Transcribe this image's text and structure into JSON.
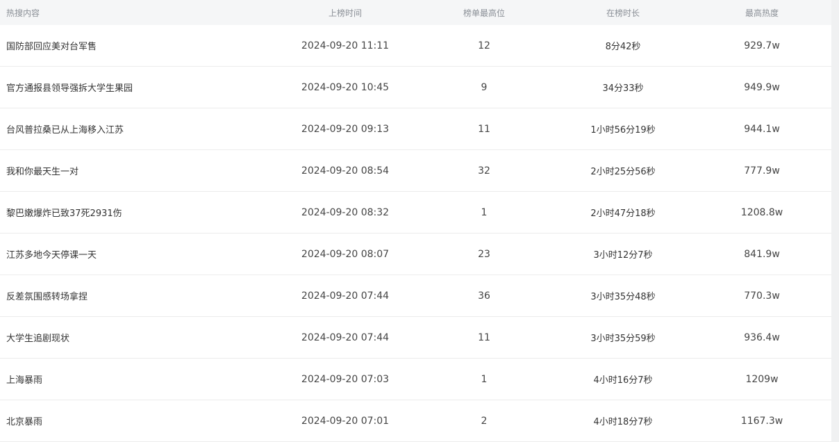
{
  "header": {
    "topic": "热搜内容",
    "time": "上榜时间",
    "rank": "榜单最高位",
    "duration": "在榜时长",
    "heat": "最高热度"
  },
  "rows": [
    {
      "topic": "国防部回应美对台军售",
      "time": "2024-09-20 11:11",
      "rank": "12",
      "duration": "8分42秒",
      "heat": "929.7w"
    },
    {
      "topic": "官方通报县领导强拆大学生果园",
      "time": "2024-09-20 10:45",
      "rank": "9",
      "duration": "34分33秒",
      "heat": "949.9w"
    },
    {
      "topic": "台风普拉桑已从上海移入江苏",
      "time": "2024-09-20 09:13",
      "rank": "11",
      "duration": "1小时56分19秒",
      "heat": "944.1w"
    },
    {
      "topic": "我和你最天生一对",
      "time": "2024-09-20 08:54",
      "rank": "32",
      "duration": "2小时25分56秒",
      "heat": "777.9w"
    },
    {
      "topic": "黎巴嫩爆炸已致37死2931伤",
      "time": "2024-09-20 08:32",
      "rank": "1",
      "duration": "2小时47分18秒",
      "heat": "1208.8w"
    },
    {
      "topic": "江苏多地今天停课一天",
      "time": "2024-09-20 08:07",
      "rank": "23",
      "duration": "3小时12分7秒",
      "heat": "841.9w"
    },
    {
      "topic": "反差氛围感转场拿捏",
      "time": "2024-09-20 07:44",
      "rank": "36",
      "duration": "3小时35分48秒",
      "heat": "770.3w"
    },
    {
      "topic": "大学生追剧现状",
      "time": "2024-09-20 07:44",
      "rank": "11",
      "duration": "3小时35分59秒",
      "heat": "936.4w"
    },
    {
      "topic": "上海暴雨",
      "time": "2024-09-20 07:03",
      "rank": "1",
      "duration": "4小时16分7秒",
      "heat": "1209w"
    },
    {
      "topic": "北京暴雨",
      "time": "2024-09-20 07:01",
      "rank": "2",
      "duration": "4小时18分7秒",
      "heat": "1167.3w"
    }
  ]
}
